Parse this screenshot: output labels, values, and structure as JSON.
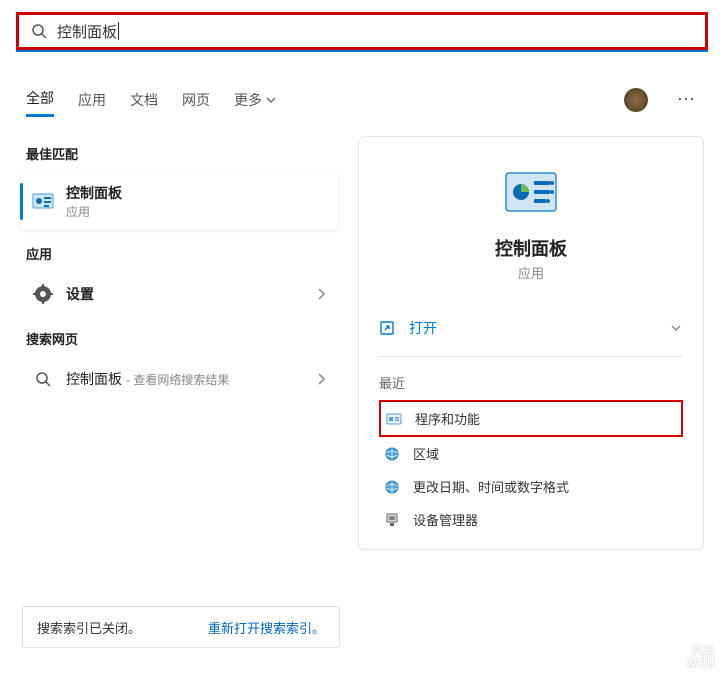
{
  "search": {
    "value": "控制面板",
    "placeholder": ""
  },
  "tabs": {
    "items": [
      "全部",
      "应用",
      "文档",
      "网页",
      "更多"
    ],
    "active": 0
  },
  "left": {
    "best_match_label": "最佳匹配",
    "best_match": {
      "title": "控制面板",
      "subtitle": "应用"
    },
    "apps_label": "应用",
    "apps": [
      {
        "title": "设置"
      }
    ],
    "web_label": "搜索网页",
    "web": [
      {
        "title": "控制面板",
        "hint": "查看网络搜索结果"
      }
    ]
  },
  "right": {
    "title": "控制面板",
    "subtitle": "应用",
    "open_label": "打开",
    "recent_label": "最近",
    "recent": [
      {
        "label": "程序和功能"
      },
      {
        "label": "区域"
      },
      {
        "label": "更改日期、时间或数字格式"
      },
      {
        "label": "设备管理器"
      }
    ]
  },
  "bottom": {
    "text": "搜索索引已关闭。",
    "link": "重新打开搜索索引。"
  },
  "watermark": {
    "l1": "新浪",
    "l2": "众测"
  }
}
